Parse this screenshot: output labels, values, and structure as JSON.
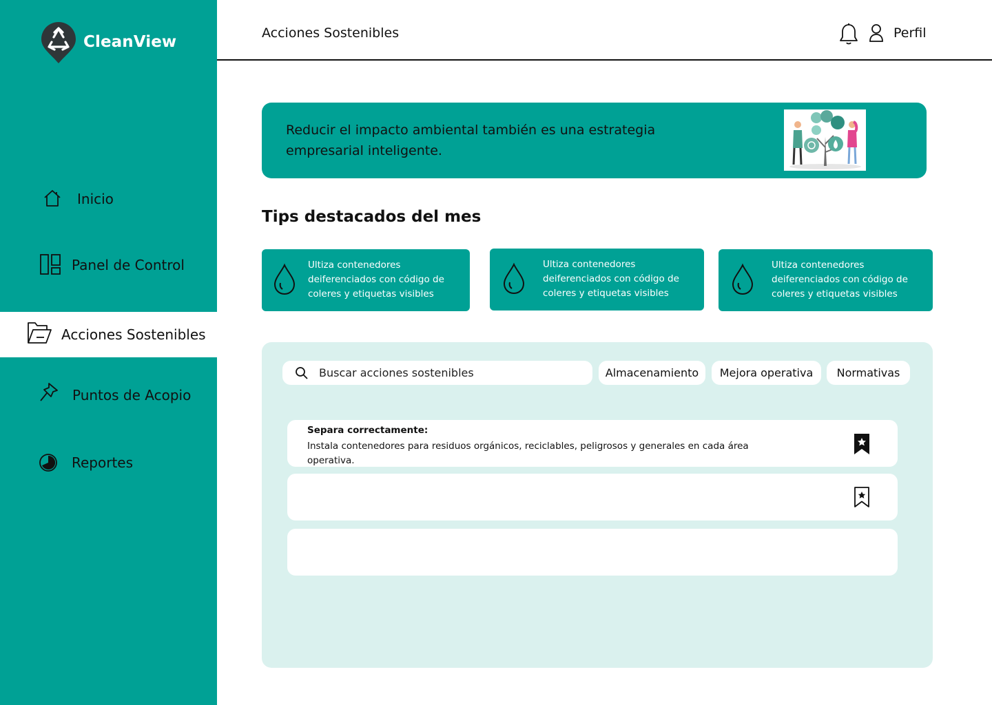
{
  "app": {
    "name": "CleanView",
    "logo_icon": "recycle-pin-icon",
    "colors": {
      "brand": "#00a195",
      "panel": "#daf1ee",
      "text": "#111111"
    }
  },
  "sidebar": {
    "items": [
      {
        "label": "Inicio",
        "icon": "home-icon",
        "active": false
      },
      {
        "label": "Panel de Control",
        "icon": "dashboard-icon",
        "active": false
      },
      {
        "label": "Acciones Sostenibles",
        "icon": "folder-open-icon",
        "active": true
      },
      {
        "label": "Puntos de Acopio",
        "icon": "pin-icon",
        "active": false
      },
      {
        "label": "Reportes",
        "icon": "pie-chart-icon",
        "active": false
      }
    ]
  },
  "header": {
    "title": "Acciones Sostenibles",
    "notification_icon": "bell-icon",
    "profile_icon": "user-icon",
    "profile_label": "Perfil"
  },
  "banner": {
    "text": "Reducir el impacto ambiental también es una estrategia empresarial inteligente.",
    "illustration": "people-planting-tree-illustration"
  },
  "tips": {
    "title": "Tips destacados del mes",
    "items": [
      {
        "icon": "water-drop-icon",
        "text": "Ultiza contenedores deiferenciados con código de coleres y etiquetas visibles"
      },
      {
        "icon": "water-drop-icon",
        "text": "Ultiza contenedores deiferenciados con código de coleres y etiquetas visibles"
      },
      {
        "icon": "water-drop-icon",
        "text": "Ultiza contenedores deiferenciados con código de coleres y etiquetas visibles"
      }
    ]
  },
  "actions": {
    "search": {
      "placeholder": "Buscar acciones sostenibles",
      "value": "",
      "icon": "search-icon"
    },
    "filters": [
      "Almacenamiento",
      "Mejora operativa",
      "Normativas"
    ],
    "cards": [
      {
        "title": "Separa correctamente:",
        "body": "Instala contenedores para residuos orgánicos, reciclables, peligrosos y generales en cada área operativa.",
        "bookmark": "bookmark-filled-icon",
        "saved": true
      },
      {
        "title": "",
        "body": "",
        "bookmark": "bookmark-outline-icon",
        "saved": false
      },
      {
        "title": "",
        "body": "",
        "bookmark": "",
        "saved": false
      }
    ]
  }
}
